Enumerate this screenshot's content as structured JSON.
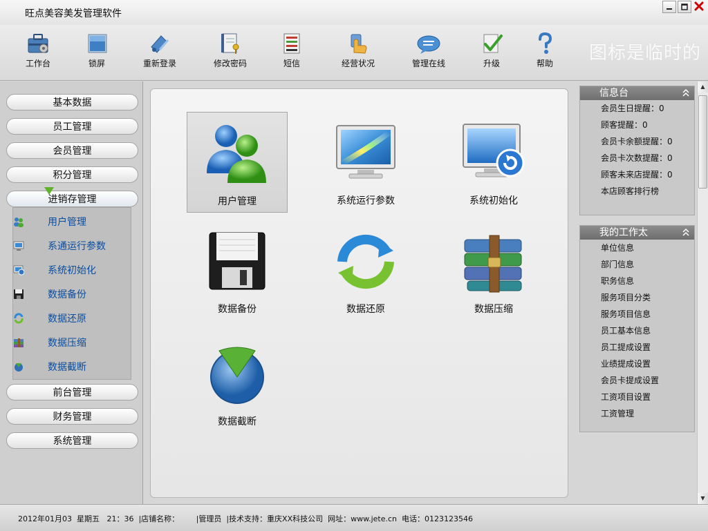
{
  "window": {
    "title": "旺点美容美发管理软件",
    "minimize_icon": "minimize-icon",
    "maximize_icon": "maximize-icon",
    "close_icon": "close-icon"
  },
  "toolbar": {
    "items": [
      {
        "label": "工作台",
        "icon": "toolbox-icon"
      },
      {
        "label": "锁屏",
        "icon": "lock-screen-icon"
      },
      {
        "label": "重新登录",
        "icon": "relogin-icon"
      },
      {
        "label": "修改密码",
        "icon": "notebook-key-icon"
      },
      {
        "label": "短信",
        "icon": "sms-icon"
      },
      {
        "label": "经营状况",
        "icon": "hand-pointer-icon"
      },
      {
        "label": "管理在线",
        "icon": "chat-bubble-icon"
      },
      {
        "label": "升级",
        "icon": "upgrade-check-icon"
      },
      {
        "label": "帮助",
        "icon": "help-question-icon"
      }
    ],
    "watermark": "图标是临时的"
  },
  "leftnav": {
    "buttons": [
      {
        "label": "基本数据"
      },
      {
        "label": "员工管理"
      },
      {
        "label": "会员管理"
      },
      {
        "label": "积分管理"
      },
      {
        "label": "进销存管理",
        "active": true
      },
      {
        "label": "前台管理"
      },
      {
        "label": "财务管理"
      },
      {
        "label": "系统管理"
      }
    ],
    "submenu": [
      {
        "label": "用户管理",
        "icon": "users-icon"
      },
      {
        "label": "系通运行参数",
        "icon": "monitor-icon"
      },
      {
        "label": "系统初始化",
        "icon": "monitor-refresh-icon"
      },
      {
        "label": "数据备份",
        "icon": "floppy-disk-icon"
      },
      {
        "label": "数据还原",
        "icon": "restore-cycle-icon"
      },
      {
        "label": "数据压缩",
        "icon": "compress-books-icon"
      },
      {
        "label": "数据截断",
        "icon": "pie-truncate-icon"
      }
    ]
  },
  "main": {
    "tiles": [
      {
        "label": "用户管理",
        "icon": "users-icon",
        "selected": true
      },
      {
        "label": "系统运行参数",
        "icon": "monitor-icon"
      },
      {
        "label": "系统初始化",
        "icon": "monitor-refresh-icon"
      },
      {
        "label": "数据备份",
        "icon": "floppy-disk-icon"
      },
      {
        "label": "数据还原",
        "icon": "restore-cycle-icon"
      },
      {
        "label": "数据压缩",
        "icon": "compress-books-icon"
      },
      {
        "label": "数据截断",
        "icon": "pie-truncate-icon"
      }
    ]
  },
  "rightside": {
    "info": {
      "title": "信息台",
      "items": [
        "会员生日提醒：0",
        "顾客提醒：0",
        "会员卡余额提醒：0",
        "会员卡次数提醒：0",
        "顾客未来店提醒：0",
        "本店顾客排行榜"
      ]
    },
    "workbench": {
      "title": "我的工作太",
      "items": [
        "单位信息",
        "部门信息",
        "职务信息",
        "服务项目分类",
        "服务项目信息",
        "员工基本信息",
        "员工提成设置",
        "业绩提成设置",
        "会员卡提成设置",
        "工资项目设置",
        "工资管理"
      ]
    }
  },
  "statusbar": {
    "text": "2012年01月03  星期五   21：36  |店铺名称：       |管理员  |技术支持：重庆XX科技公司  网址：www.jete.cn  电话：0123123546"
  },
  "colors": {
    "accent_blue": "#0b4ea0",
    "header_gray": "#7a7a7a",
    "nav_arrow_green": "#5fb32a",
    "close_red": "#cc0000"
  }
}
